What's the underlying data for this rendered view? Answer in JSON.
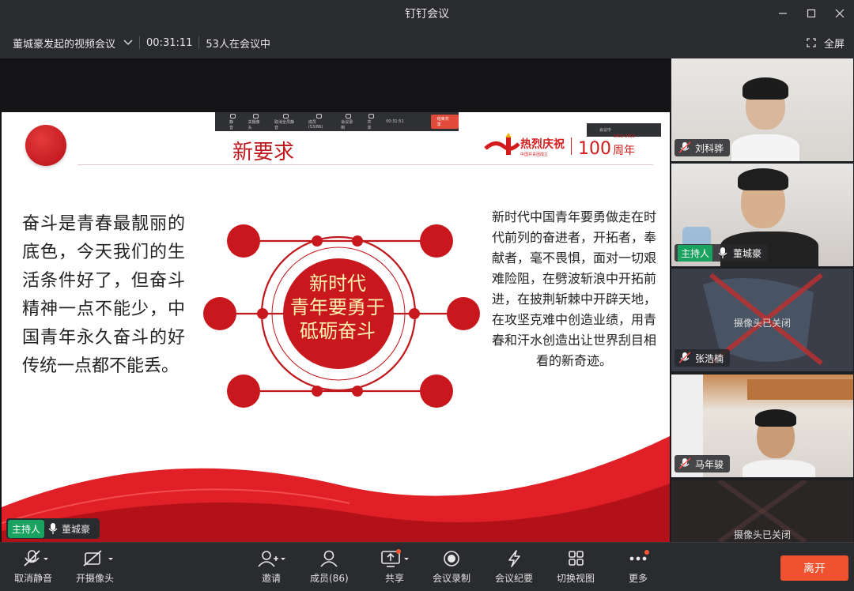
{
  "window": {
    "title": "钉钉会议"
  },
  "infobar": {
    "meeting_name": "董城豪发起的视频会议",
    "duration": "00:31:11",
    "attendees": "53人在会议中",
    "fullscreen_label": "全屏"
  },
  "slide": {
    "mini_toolbar": {
      "items": [
        "静音",
        "关摄像头",
        "取消全员静音",
        "成员(53/86)",
        "会议录制",
        "共享"
      ],
      "timer": "00:31:51",
      "stop_label": "结束共享",
      "dropdown": "会议中"
    },
    "title": "新要求",
    "logo_hot": "热烈庆祝",
    "logo_sub": "中国共青团成立",
    "logo_years_range": "1922-2022",
    "logo_hundred": "100",
    "logo_years": "周年",
    "left_text": "奋斗是青春最靓丽的底色，今天我们的生活条件好了，但奋斗精神一点不能少，中国青年永久奋斗的好传统一点都不能丢。",
    "center_line1": "新时代",
    "center_line2": "青年要勇于",
    "center_line3": "砥砺奋斗",
    "right_text": "新时代中国青年要勇做走在时代前列的奋进者，开拓者，奉献者，毫不畏惧，面对一切艰难险阻，在劈波斩浪中开拓前进，在披荆斩棘中开辟天地，在攻坚克难中创造业绩，用青春和汗水创造出让世界刮目相看的新奇迹。"
  },
  "main_host_tag": {
    "badge": "主持人",
    "name": "董城豪"
  },
  "participants": [
    {
      "name": "刘科骅",
      "host": false,
      "camera_off": false
    },
    {
      "name": "董城豪",
      "host": true,
      "host_label": "主持人",
      "camera_off": false
    },
    {
      "name": "张浩楠",
      "host": false,
      "camera_off": true,
      "camera_off_label": "摄像头已关闭"
    },
    {
      "name": "马年骏",
      "host": false,
      "camera_off": false
    },
    {
      "name": "",
      "host": false,
      "camera_off": true,
      "camera_off_label": "摄像头已关闭"
    }
  ],
  "toolbar": {
    "mute_label": "取消静音",
    "camera_label": "开摄像头",
    "invite_label": "邀请",
    "members_label": "成员(86)",
    "share_label": "共享",
    "record_label": "会议录制",
    "minutes_label": "会议纪要",
    "view_label": "切换视图",
    "more_label": "更多",
    "leave_label": "离开"
  },
  "colors": {
    "accent_red": "#c0171c",
    "leave_orange": "#f0522f",
    "host_green": "#1aa260"
  }
}
